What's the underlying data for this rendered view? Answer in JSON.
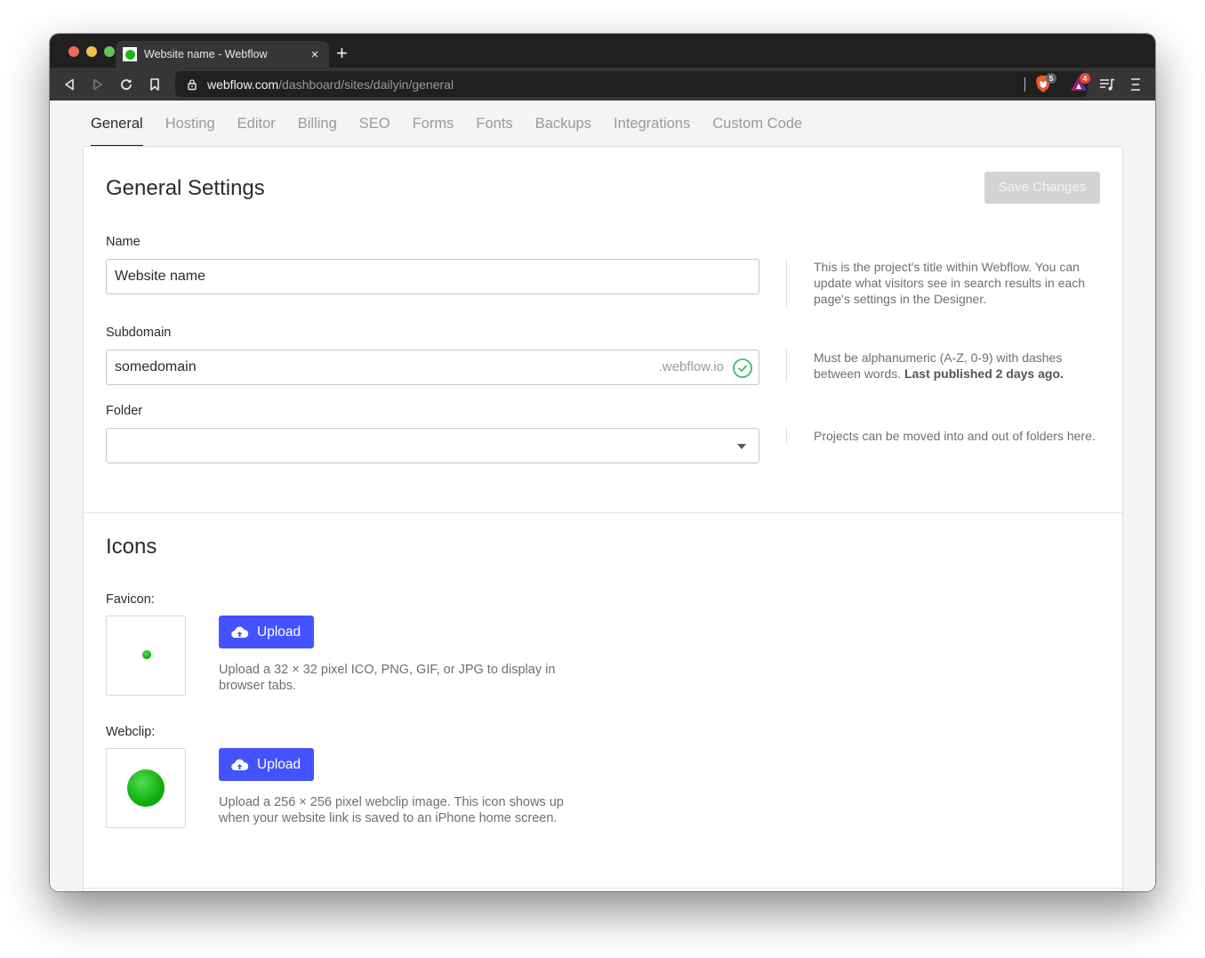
{
  "browser": {
    "tab_title": "Website name - Webflow",
    "close_glyph": "×",
    "new_tab_glyph": "+",
    "url_domain": "webflow.com",
    "url_path": "/dashboard/sites/dailyin/general",
    "brave_shield_count": "5",
    "rewards_count": "4"
  },
  "nav_tabs": [
    {
      "label": "General",
      "active": true
    },
    {
      "label": "Hosting"
    },
    {
      "label": "Editor"
    },
    {
      "label": "Billing"
    },
    {
      "label": "SEO"
    },
    {
      "label": "Forms"
    },
    {
      "label": "Fonts"
    },
    {
      "label": "Backups"
    },
    {
      "label": "Integrations"
    },
    {
      "label": "Custom Code"
    }
  ],
  "general": {
    "title": "General Settings",
    "save_label": "Save Changes",
    "name": {
      "label": "Name",
      "value": "Website name",
      "help": "This is the project's title within Webflow. You can update what visitors see in search results in each page's settings in the Designer."
    },
    "subdomain": {
      "label": "Subdomain",
      "value": "somedomain",
      "suffix": ".webflow.io",
      "help": "Must be alphanumeric (A-Z, 0-9) with dashes between words.",
      "help_bold": "Last published 2 days ago."
    },
    "folder": {
      "label": "Folder",
      "value": "",
      "help": "Projects can be moved into and out of folders here."
    }
  },
  "icons": {
    "title": "Icons",
    "favicon": {
      "label": "Favicon:",
      "upload_label": "Upload",
      "description": "Upload a 32 × 32 pixel ICO, PNG, GIF, or JPG to display in browser tabs."
    },
    "webclip": {
      "label": "Webclip:",
      "upload_label": "Upload",
      "description": "Upload a 256 × 256 pixel webclip image. This icon shows up when your website link is saved to an iPhone home screen."
    }
  },
  "colors": {
    "accent": "#4353ff",
    "success": "#3fb86a",
    "favicon_green": "#1bb61b"
  }
}
